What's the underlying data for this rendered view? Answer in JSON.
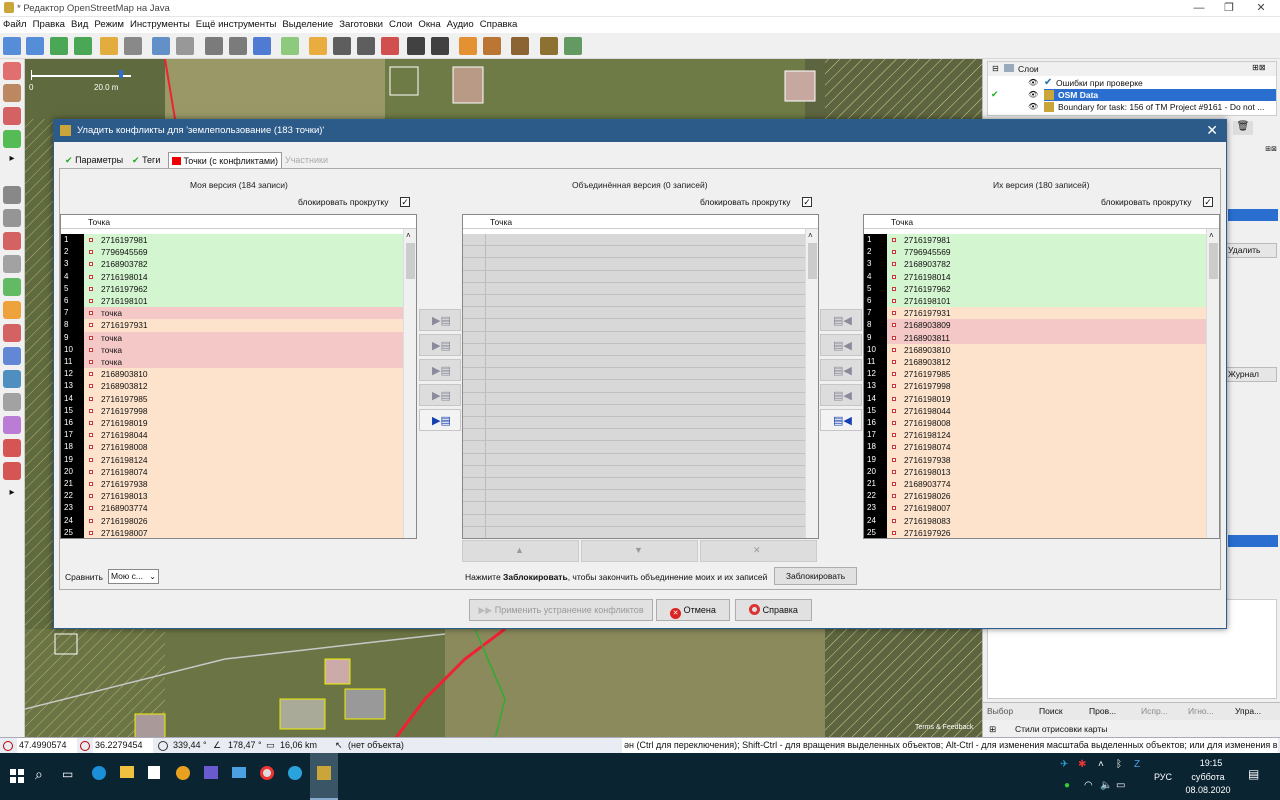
{
  "window": {
    "title": "* Редактор OpenStreetMap на Java"
  },
  "menu": [
    "Файл",
    "Правка",
    "Вид",
    "Режим",
    "Инструменты",
    "Ещё инструменты",
    "Выделение",
    "Заготовки",
    "Слои",
    "Окна",
    "Аудио",
    "Справка"
  ],
  "map": {
    "scale_label": "20.0 m",
    "scale_zero": "0",
    "attribution": "Terms & Feedback"
  },
  "layers_panel": {
    "title": "Слои",
    "items": [
      "Ошибки при проверке",
      "OSM Data",
      "Boundary for task: 156 of TM Project #9161 - Do not ..."
    ],
    "side_labels": {
      "delete": "Удалить",
      "journal": "Журнал"
    }
  },
  "right_bottom": {
    "tabs": [
      "Выбор",
      "Поиск",
      "Пров...",
      "Испр...",
      "Игно...",
      "Упра..."
    ],
    "styles_title": "Стили отрисовки карты"
  },
  "dialog": {
    "title": "Уладить конфликты для 'землепользование (183 точки)'",
    "tabs": [
      "Параметры",
      "Теги",
      "Точки (с конфликтами)",
      "Участники"
    ],
    "my_header": "Моя версия (184 записи)",
    "merged_header": "Объединённая версия (0 записей)",
    "their_header": "Их версия (180 записей)",
    "lock_scroll": "блокировать прокрутку",
    "column": "Точка",
    "my_rows": [
      {
        "n": "1",
        "v": "2716197981",
        "s": "g"
      },
      {
        "n": "2",
        "v": "7796945569",
        "s": "g"
      },
      {
        "n": "3",
        "v": "2168903782",
        "s": "g"
      },
      {
        "n": "4",
        "v": "2716198014",
        "s": "g"
      },
      {
        "n": "5",
        "v": "2716197962",
        "s": "g"
      },
      {
        "n": "6",
        "v": "2716198101",
        "s": "g"
      },
      {
        "n": "7",
        "v": "точка",
        "s": "r"
      },
      {
        "n": "8",
        "v": "2716197931",
        "s": "o"
      },
      {
        "n": "9",
        "v": "точка",
        "s": "r"
      },
      {
        "n": "10",
        "v": "точка",
        "s": "r"
      },
      {
        "n": "11",
        "v": "точка",
        "s": "r"
      },
      {
        "n": "12",
        "v": "2168903810",
        "s": "o"
      },
      {
        "n": "13",
        "v": "2168903812",
        "s": "o"
      },
      {
        "n": "14",
        "v": "2716197985",
        "s": "o"
      },
      {
        "n": "15",
        "v": "2716197998",
        "s": "o"
      },
      {
        "n": "16",
        "v": "2716198019",
        "s": "o"
      },
      {
        "n": "17",
        "v": "2716198044",
        "s": "o"
      },
      {
        "n": "18",
        "v": "2716198008",
        "s": "o"
      },
      {
        "n": "19",
        "v": "2716198124",
        "s": "o"
      },
      {
        "n": "20",
        "v": "2716198074",
        "s": "o"
      },
      {
        "n": "21",
        "v": "2716197938",
        "s": "o"
      },
      {
        "n": "22",
        "v": "2716198013",
        "s": "o"
      },
      {
        "n": "23",
        "v": "2168903774",
        "s": "o"
      },
      {
        "n": "24",
        "v": "2716198026",
        "s": "o"
      },
      {
        "n": "25",
        "v": "2716198007",
        "s": "o"
      }
    ],
    "their_rows": [
      {
        "n": "1",
        "v": "2716197981",
        "s": "g"
      },
      {
        "n": "2",
        "v": "7796945569",
        "s": "g"
      },
      {
        "n": "3",
        "v": "2168903782",
        "s": "g"
      },
      {
        "n": "4",
        "v": "2716198014",
        "s": "g"
      },
      {
        "n": "5",
        "v": "2716197962",
        "s": "g"
      },
      {
        "n": "6",
        "v": "2716198101",
        "s": "g"
      },
      {
        "n": "7",
        "v": "2716197931",
        "s": "o"
      },
      {
        "n": "8",
        "v": "2168903809",
        "s": "r"
      },
      {
        "n": "9",
        "v": "2168903811",
        "s": "r"
      },
      {
        "n": "10",
        "v": "2168903810",
        "s": "o"
      },
      {
        "n": "11",
        "v": "2168903812",
        "s": "o"
      },
      {
        "n": "12",
        "v": "2716197985",
        "s": "o"
      },
      {
        "n": "13",
        "v": "2716197998",
        "s": "o"
      },
      {
        "n": "14",
        "v": "2716198019",
        "s": "o"
      },
      {
        "n": "15",
        "v": "2716198044",
        "s": "o"
      },
      {
        "n": "16",
        "v": "2716198008",
        "s": "o"
      },
      {
        "n": "17",
        "v": "2716198124",
        "s": "o"
      },
      {
        "n": "18",
        "v": "2716198074",
        "s": "o"
      },
      {
        "n": "19",
        "v": "2716197938",
        "s": "o"
      },
      {
        "n": "20",
        "v": "2716198013",
        "s": "o"
      },
      {
        "n": "21",
        "v": "2168903774",
        "s": "o"
      },
      {
        "n": "22",
        "v": "2716198026",
        "s": "o"
      },
      {
        "n": "23",
        "v": "2716198007",
        "s": "o"
      },
      {
        "n": "24",
        "v": "2716198083",
        "s": "o"
      },
      {
        "n": "25",
        "v": "2716197926",
        "s": "o"
      }
    ],
    "compare_label": "Сравнить",
    "compare_value": "Мою с...",
    "hint_prefix": "Нажмите ",
    "hint_bold": "Заблокировать",
    "hint_suffix": ", чтобы закончить объединение моих и их записей",
    "lock_button": "Заблокировать",
    "apply_button": "Применить устранение конфликтов",
    "cancel_button": "Отмена",
    "help_button": "Справка"
  },
  "statusbar": {
    "lat": "47.4990574",
    "lon": "36.2279454",
    "heading": "339,44 °",
    "angle": "178,47 °",
    "distance": "16,06 km",
    "object": "(нет объекта)",
    "help": "ән (Ctrl для переключения); Shift-Ctrl - для вращения выделенных объектов; Alt-Ctrl - для изменения масштаба выделенных объектов; или для изменения выделения"
  },
  "taskbar": {
    "lang": "РУС",
    "time": "19:15",
    "day": "суббота",
    "date": "08.08.2020"
  }
}
